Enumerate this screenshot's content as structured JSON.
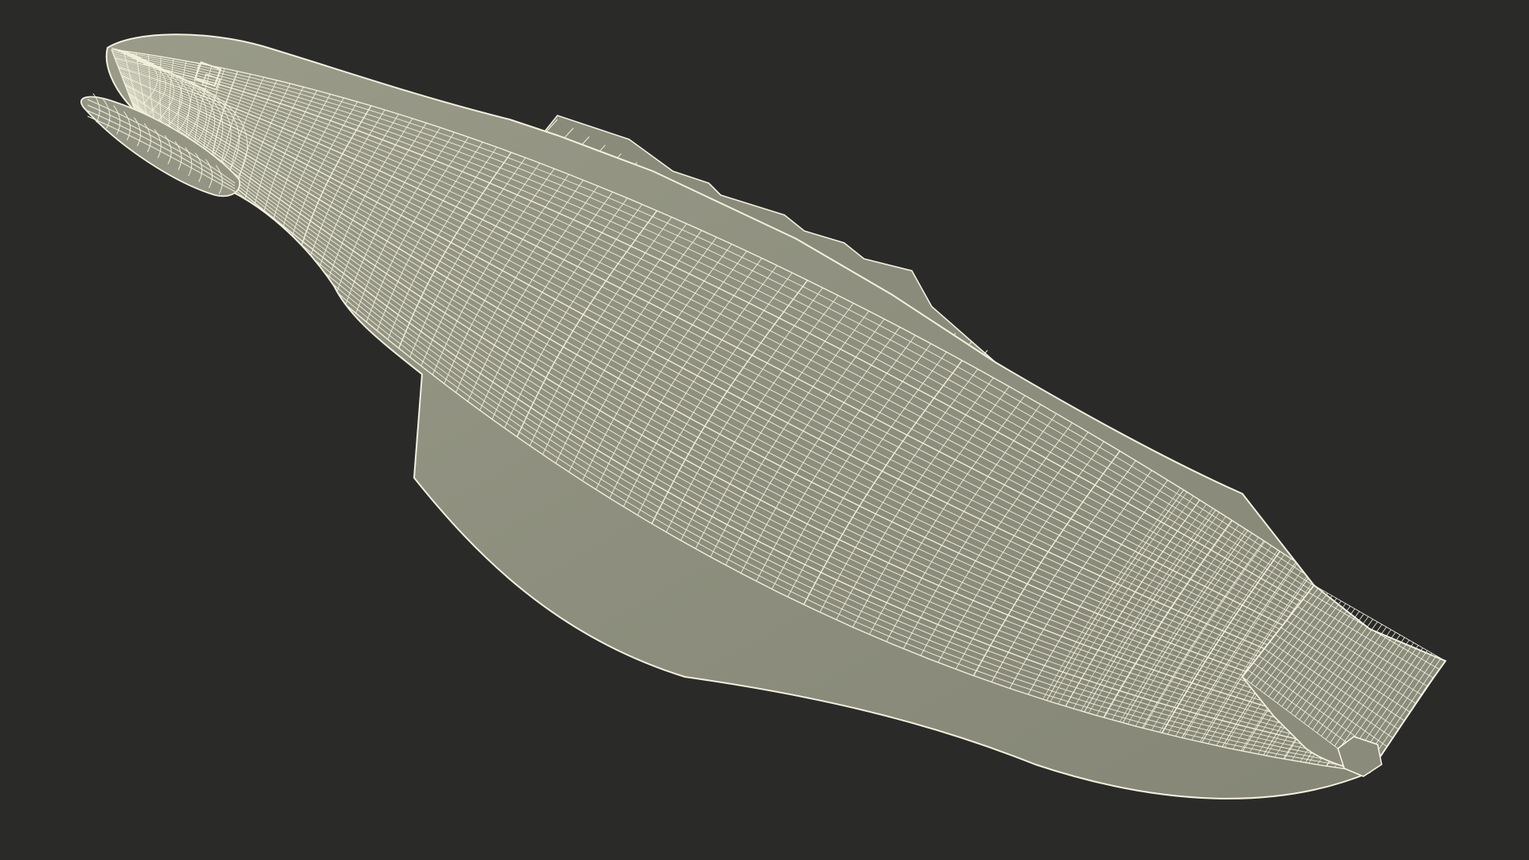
{
  "scene": {
    "subject": "ship-hull-wireframe",
    "view": "underside-perspective",
    "colors": {
      "background": "#2a2a29",
      "hull_fill": "#8e8f7e",
      "hull_fill_dark": "#7d7e6d",
      "wire": "#f3f0de",
      "wire_dense": "#fbf8ea"
    }
  }
}
